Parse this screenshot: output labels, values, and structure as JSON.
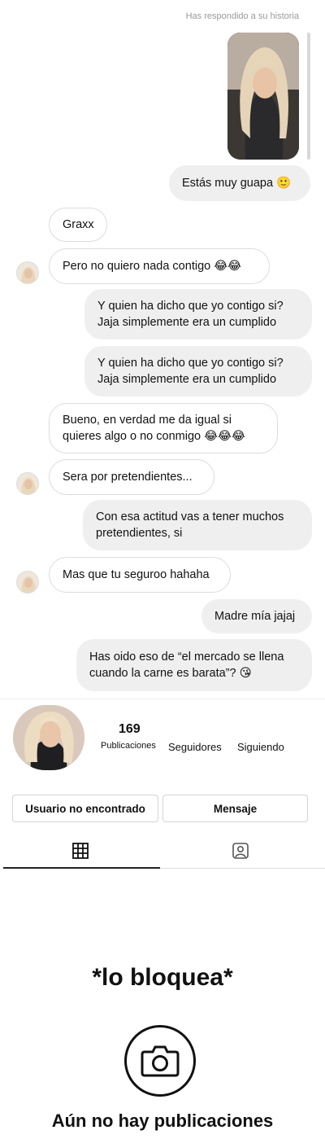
{
  "story_reply": {
    "label": "Has respondido a su historia"
  },
  "messages": [
    {
      "id": "m1",
      "side": "out",
      "lines": [
        "Estás muy guapa 🙂"
      ]
    },
    {
      "id": "m2",
      "side": "in",
      "lines": [
        "Graxx"
      ]
    },
    {
      "id": "m3",
      "side": "in",
      "lines": [
        "Pero no quiero nada contigo 😂😂"
      ]
    },
    {
      "id": "m4",
      "side": "out",
      "lines": [
        "Y quien ha dicho que yo contigo si?",
        "Jaja simplemente era un cumplido"
      ]
    },
    {
      "id": "m5",
      "side": "out",
      "lines": [
        "Y quien ha dicho que yo contigo si?",
        "Jaja simplemente era un cumplido"
      ]
    },
    {
      "id": "m6",
      "side": "in",
      "lines": [
        "Bueno, en verdad me da igual si",
        "quieres algo o no conmigo 😂😂😂"
      ]
    },
    {
      "id": "m7",
      "side": "in",
      "lines": [
        "Sera por pretendientes..."
      ]
    },
    {
      "id": "m8",
      "side": "out",
      "lines": [
        "Con esa actitud vas a tener muchos",
        "pretendientes, si"
      ]
    },
    {
      "id": "m9",
      "side": "in",
      "lines": [
        "Mas que tu seguroo hahaha"
      ]
    },
    {
      "id": "m10",
      "side": "out",
      "lines": [
        "Madre mía jajaj"
      ]
    },
    {
      "id": "m11",
      "side": "out",
      "lines": [
        "Has oido eso de “el mercado se llena",
        "cuando la carne es barata”? 😘"
      ]
    }
  ],
  "profile": {
    "posts_count": "169",
    "posts_label": "Publicaciones",
    "followers_label": "Seguidores",
    "following_label": "Siguiendo",
    "user_button": "Usuario no encontrado",
    "message_button": "Mensaje"
  },
  "caption": "*lo bloquea*",
  "empty_state": {
    "title": "Aún no hay publicaciones"
  },
  "icons": {
    "grid": "grid-icon",
    "tagged": "tagged-person-icon",
    "camera": "camera-icon"
  }
}
